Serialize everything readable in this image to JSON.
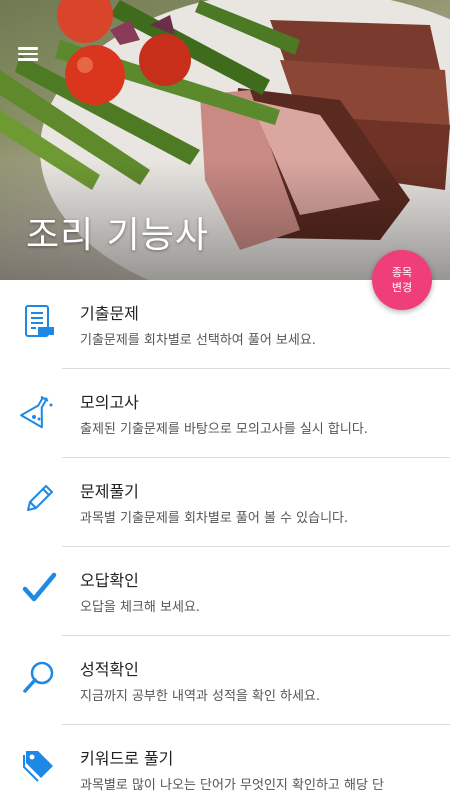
{
  "header": {
    "title": "조리 기능사",
    "change_button_line1": "종목",
    "change_button_line2": "변경"
  },
  "menu": [
    {
      "title": "기출문제",
      "desc": "기출문제를 회차별로 선택하여 풀어 보세요.",
      "icon": "exam-sheet-icon"
    },
    {
      "title": "모의고사",
      "desc": "출제된 기출문제를 바탕으로 모의고사를 실시 합니다.",
      "icon": "flask-icon"
    },
    {
      "title": "문제풀기",
      "desc": "과목별 기출문제를 회차별로 풀어 볼 수 있습니다.",
      "icon": "pencil-icon"
    },
    {
      "title": "오답확인",
      "desc": "오답을 체크해 보세요.",
      "icon": "checkmark-icon"
    },
    {
      "title": "성적확인",
      "desc": "지금까지 공부한 내역과 성적을 확인 하세요.",
      "icon": "magnifier-icon"
    },
    {
      "title": "키워드로 풀기",
      "desc": "과목별로 많이 나오는 단어가 무엇인지 확인하고 해당 단",
      "icon": "tag-icon"
    }
  ],
  "colors": {
    "accent": "#1e88e5",
    "fab": "#f03e7b"
  }
}
